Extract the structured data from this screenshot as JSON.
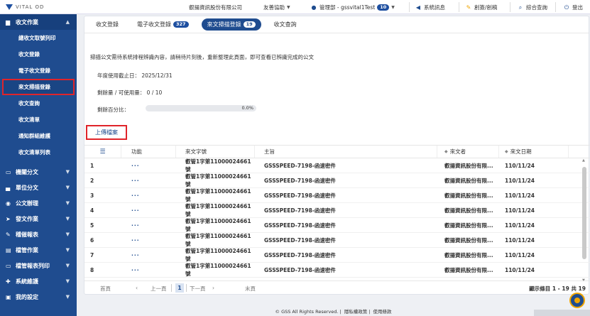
{
  "app": {
    "logo_text": "VITAL OD",
    "company": "叡揚資訊股份有限公司"
  },
  "topbar": {
    "assist": "友善協助",
    "user": "管理部 - gssvital1Test",
    "user_badge": "10",
    "system_msg": "系統訊息",
    "create": "創簽/創稿",
    "search": "綜合查詢",
    "logout": "登出"
  },
  "sidebar": {
    "groups": [
      {
        "label": "收文作業",
        "icon": "folder-icon",
        "open": true,
        "items": [
          "總收文取號列印",
          "收文登錄",
          "電子收文登錄",
          "來文掃描登錄",
          "收文查詢",
          "收文清單",
          "通知群組維護",
          "收文清單列表"
        ]
      },
      {
        "label": "機關分文",
        "icon": "folder-open-icon"
      },
      {
        "label": "單位分文",
        "icon": "inbox-icon"
      },
      {
        "label": "公文辦理",
        "icon": "car-icon"
      },
      {
        "label": "發文作業",
        "icon": "send-icon"
      },
      {
        "label": "稽催報表",
        "icon": "pencil-icon"
      },
      {
        "label": "檔管作業",
        "icon": "archive-icon"
      },
      {
        "label": "檔管報表列印",
        "icon": "folder-icon"
      },
      {
        "label": "系統維護",
        "icon": "wrench-icon"
      },
      {
        "label": "我的設定",
        "icon": "user-icon"
      }
    ]
  },
  "tabs": [
    {
      "label": "收文登錄",
      "badge": ""
    },
    {
      "label": "電子收文登錄",
      "badge": "327"
    },
    {
      "label": "來文掃描登錄",
      "badge": "19"
    },
    {
      "label": "收文查詢",
      "badge": ""
    }
  ],
  "notice": "掃描公文需待系統排程辨識內容，請稍待片刻後，重新整理此頁面，即可查看已辨識完成的公文",
  "info": {
    "expiry": "年度使用截止日： 2025/12/31",
    "quota": "剩餘量 / 可使用量： 0 / 10",
    "percent_label": "剩餘百分比：",
    "percent_text": "0.0%",
    "percent_value": 0.0
  },
  "upload_label": "上傳檔案",
  "table": {
    "headers": [
      "功能",
      "來文字號",
      "主旨",
      "來文者",
      "來文日期"
    ],
    "rows": [
      [
        "1",
        "···",
        "叡管1字第11000024661號",
        "GSSSPEED-7198-函速密件",
        "叡揚資訊股份有限...",
        "110/11/24"
      ],
      [
        "2",
        "···",
        "叡管1字第11000024661號",
        "GSSSPEED-7198-函速密件",
        "叡揚資訊股份有限...",
        "110/11/24"
      ],
      [
        "3",
        "···",
        "叡管1字第11000024661號",
        "GSSSPEED-7198-函速密件",
        "叡揚資訊股份有限...",
        "110/11/24"
      ],
      [
        "4",
        "···",
        "叡管1字第11000024661號",
        "GSSSPEED-7198-函速密件",
        "叡揚資訊股份有限...",
        "110/11/24"
      ],
      [
        "5",
        "···",
        "叡管1字第11000024661號",
        "GSSSPEED-7198-函速密件",
        "叡揚資訊股份有限...",
        "110/11/24"
      ],
      [
        "6",
        "···",
        "叡管1字第11000024661號",
        "GSSSPEED-7198-函速密件",
        "叡揚資訊股份有限...",
        "110/11/24"
      ],
      [
        "7",
        "···",
        "叡管1字第11000024661號",
        "GSSSPEED-7198-函速密件",
        "叡揚資訊股份有限...",
        "110/11/24"
      ],
      [
        "8",
        "···",
        "叡管1字第11000024661號",
        "GSSSPEED-7198-函速密件",
        "叡揚資訊股份有限...",
        "110/11/24"
      ]
    ]
  },
  "pager": {
    "first": "首頁",
    "prev": "上一頁",
    "current": "1",
    "next": "下一頁",
    "last": "末頁",
    "info": "顯示條目 1 - 19 共 19"
  },
  "footer": {
    "copyright": "© GSS All Rights Reserved.",
    "privacy": "隱私權政策",
    "terms": "使用條款"
  }
}
